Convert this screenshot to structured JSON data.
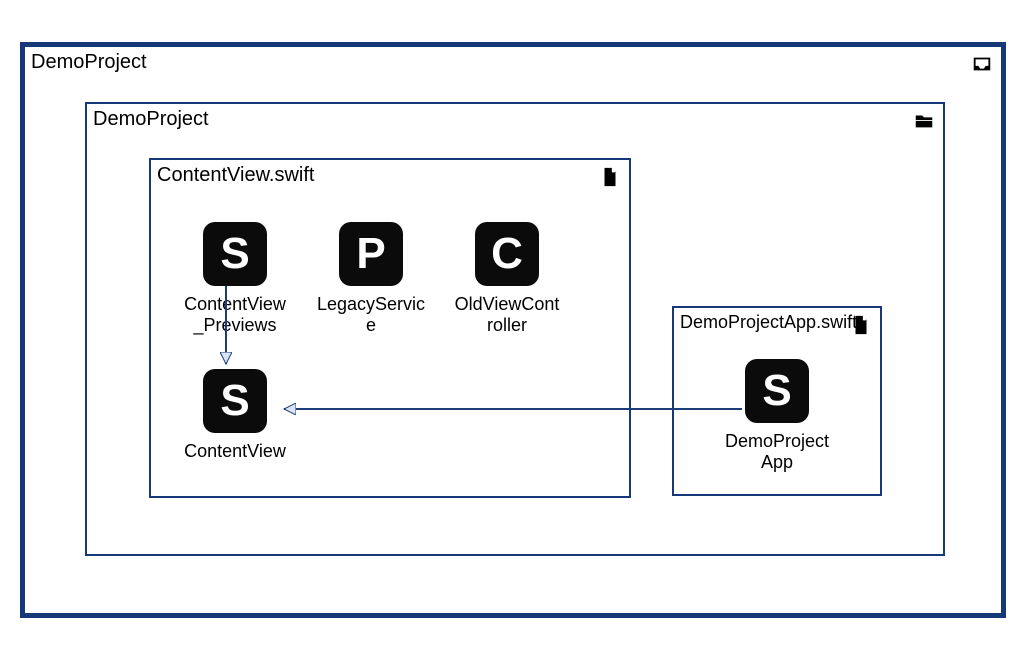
{
  "outer": {
    "title": "DemoProject",
    "icon": "inbox-icon"
  },
  "mid": {
    "title": "DemoProject",
    "icon": "folder-icon"
  },
  "file_contentview": {
    "title": "ContentView.swift",
    "icon": "file-icon"
  },
  "file_app": {
    "title": "DemoProjectApp.swift",
    "icon": "file-icon"
  },
  "nodes": {
    "previews": {
      "letter": "S",
      "label": "ContentView_Previews"
    },
    "legacy": {
      "letter": "P",
      "label": "LegacyService"
    },
    "oldvc": {
      "letter": "C",
      "label": "OldViewController"
    },
    "contentview": {
      "letter": "S",
      "label": "ContentView"
    },
    "app": {
      "letter": "S",
      "label": "DemoProjectApp"
    }
  },
  "edges": [
    {
      "from": "previews",
      "to": "contentview"
    },
    {
      "from": "app",
      "to": "contentview"
    }
  ]
}
